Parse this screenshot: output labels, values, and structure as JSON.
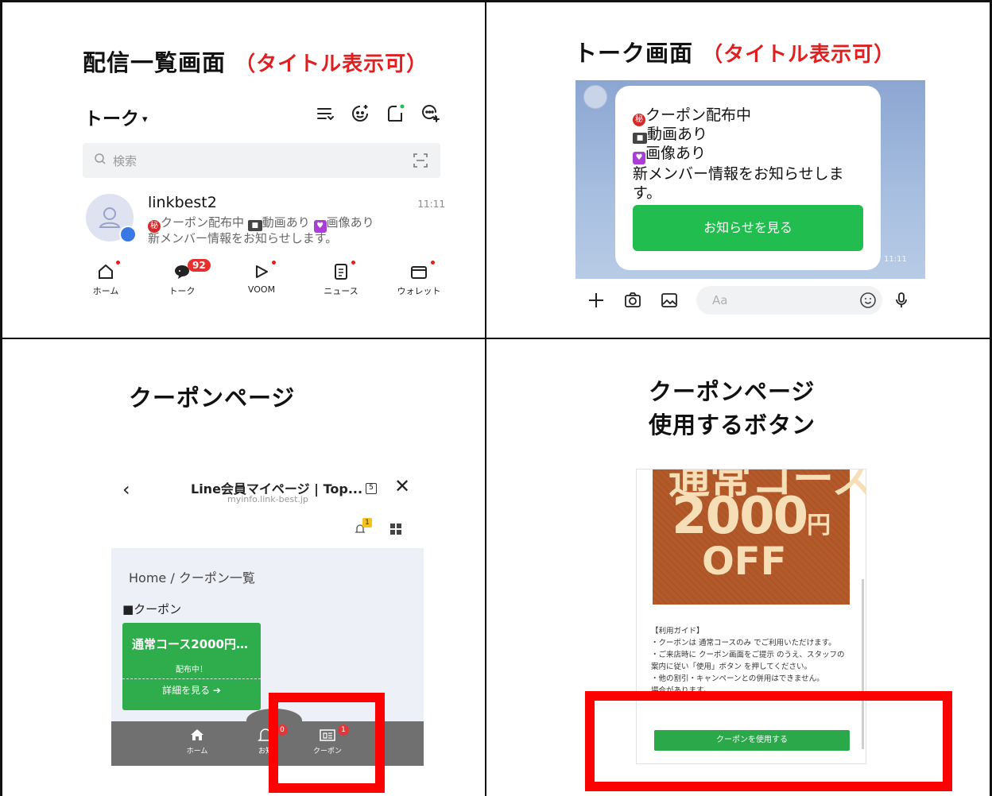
{
  "panels": {
    "p1_title": "配信一覧画面",
    "p1_note": "（タイトル表示可）",
    "p2_title": "トーク画面",
    "p2_note": "（タイトル表示可）",
    "p3_title": "クーポンページ",
    "p4_title_1": "クーポンページ",
    "p4_title_2": "使用するボタン"
  },
  "talk_list": {
    "header_title": "トーク",
    "search_placeholder": "検索",
    "chat_name": "linkbest2",
    "chat_time": "11:11",
    "preview_coupon": "クーポン配布中",
    "preview_video": "動画あり",
    "preview_image": "画像あり",
    "preview_line2": "新メンバー情報をお知らせします。",
    "badge_secret": "秘",
    "unread_count": "92",
    "nav": [
      "ホーム",
      "トーク",
      "VOOM",
      "ニュース",
      "ウォレット"
    ]
  },
  "chat": {
    "line1": "クーポン配布中",
    "line2": "動画あり",
    "line3": "画像あり",
    "line4": "新メンバー情報をお知らせしま",
    "line5": "す。",
    "badge_secret": "秘",
    "button_label": "お知らせを見る",
    "time": "11:11",
    "input_placeholder": "Aa"
  },
  "coupon_page": {
    "title": "Line会員マイページ | Top...",
    "url": "myinfo.link-best.jp",
    "tab_count": "5",
    "bell_count": "1",
    "breadcrumb": "Home / クーポン一覧",
    "section": "■クーポン",
    "card_title": "通常コース2000円…",
    "card_status": "配布中！",
    "card_link": "詳細を見る ➔",
    "footer": [
      "ホーム",
      "お知",
      "クーポン"
    ],
    "badge_notice": "0",
    "badge_coupon": "1"
  },
  "coupon_use": {
    "banner_cut": "通常コース",
    "banner_amount": "2000",
    "banner_yen": "円",
    "banner_off": "OFF",
    "guide_title": "【利用ガイド】",
    "guide_1": "・クーポンは 通常コースのみ でご利用いただけます。",
    "guide_2": "・ご来店時に クーポン画面をご提示 のうえ、スタッフの案内に従い「使用」ボタン を押してください。",
    "guide_3": "・他の割引・キャンペーンとの併用はできません。",
    "guide_4": "場合があります。",
    "use_button": "クーポンを使用する"
  },
  "colors": {
    "grid_line": "#111111",
    "highlight": "#ff0000",
    "title_note": "#e02020",
    "line_green": "#22bd4f",
    "coupon_green": "#2fac4c",
    "banner_brown": "#b4592a"
  }
}
